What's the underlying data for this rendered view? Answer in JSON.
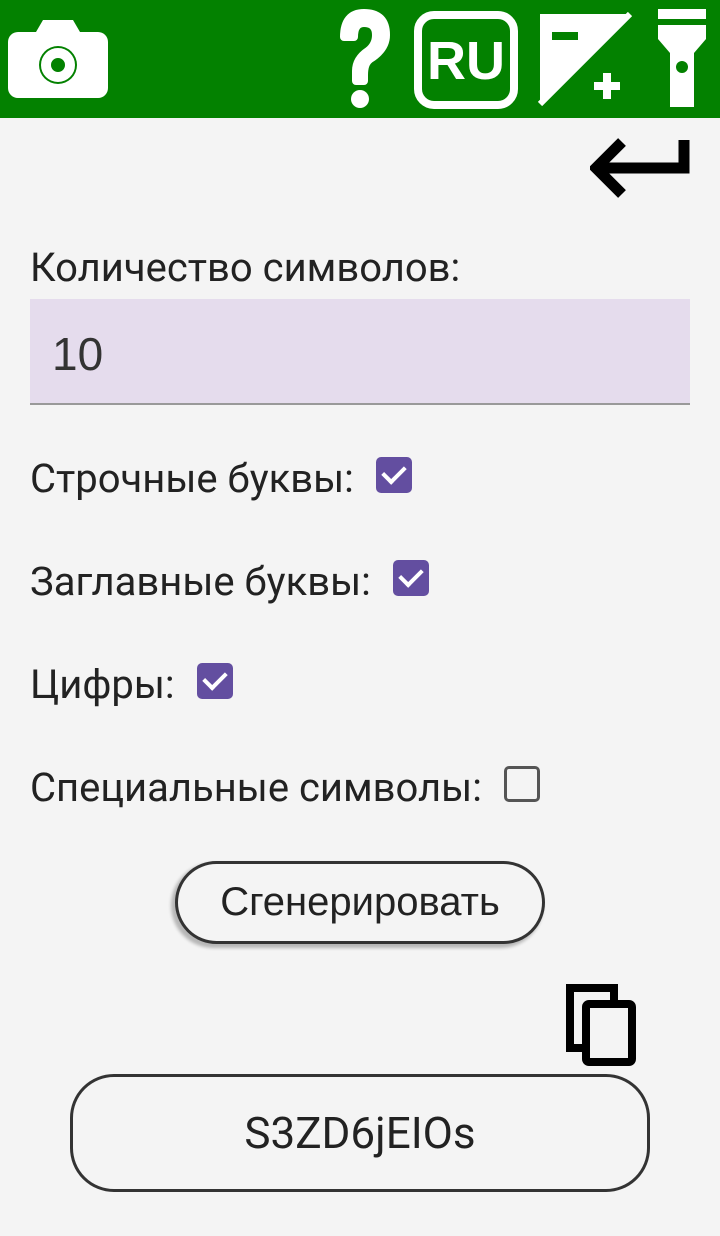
{
  "topbar": {
    "lang": "RU"
  },
  "form": {
    "count_label": "Количество символов:",
    "count_value": "10",
    "lowercase_label": "Строчные буквы:",
    "lowercase_checked": true,
    "uppercase_label": "Заглавные буквы:",
    "uppercase_checked": true,
    "digits_label": "Цифры:",
    "digits_checked": true,
    "special_label": "Специальные символы:",
    "special_checked": false,
    "generate_label": "Сгенерировать",
    "result": "S3ZD6jEIOs"
  }
}
